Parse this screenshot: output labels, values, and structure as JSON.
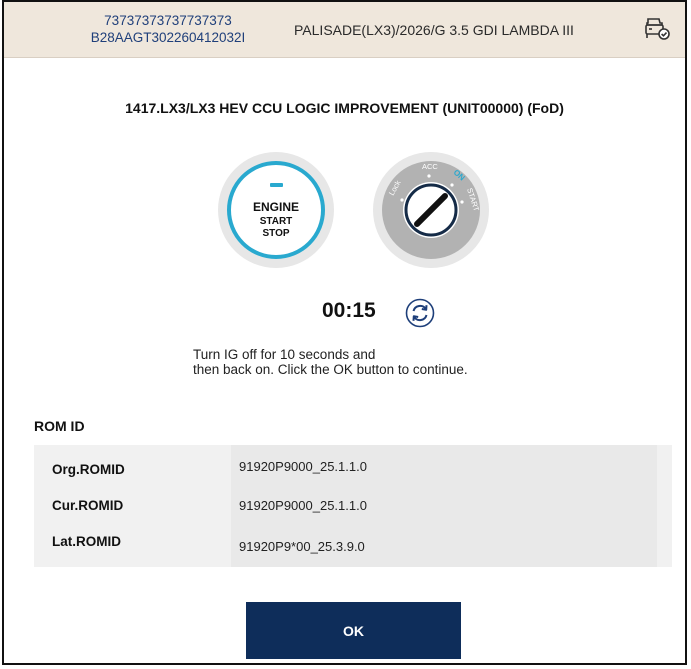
{
  "header": {
    "vin_line1": "73737373737737373",
    "vin_line2": "B28AAGT302260412032I",
    "vehicle": "PALISADE(LX3)/2026/G 3.5 GDI LAMBDA III",
    "vehicle_icon": "car-check-icon"
  },
  "main": {
    "title": "1417.LX3/LX3 HEV CCU LOGIC IMPROVEMENT (UNIT00000) (FoD)",
    "engine_button": {
      "line1": "ENGINE",
      "line2": "START",
      "line3": "STOP"
    },
    "ignition": {
      "lock": "Lock",
      "acc": "ACC",
      "on": "ON",
      "start": "START"
    },
    "timer": "00:15",
    "refresh_icon": "refresh-icon",
    "instruction": {
      "line1": "Turn IG off for 10 seconds and",
      "line2": "then back on. Click the OK button to continue."
    }
  },
  "rom": {
    "heading": "ROM ID",
    "rows": [
      {
        "label": "Org.ROMID",
        "value": "91920P9000_25.1.1.0"
      },
      {
        "label": "Cur.ROMID",
        "value": "91920P9000_25.1.1.0"
      },
      {
        "label": "Lat.ROMID",
        "value": "91920P9*00_25.3.9.0"
      }
    ]
  },
  "ok_label": "OK",
  "colors": {
    "accent": "#29a9cf",
    "header_bg": "#efe7dc",
    "primary_button": "#0e2d5a",
    "vin_text": "#1f3f7a"
  }
}
